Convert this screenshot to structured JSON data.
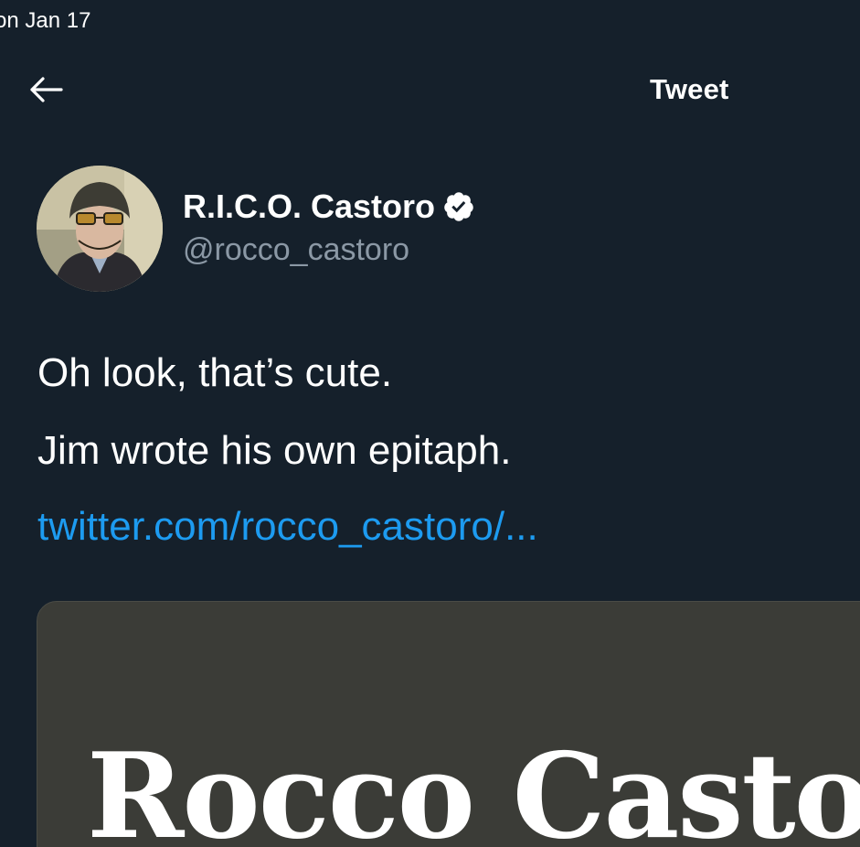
{
  "status_bar": {
    "time_text": "on Jan 17"
  },
  "header": {
    "back_icon": "arrow-left-icon",
    "title": "Tweet"
  },
  "author": {
    "name": "R.I.C.O. Castoro",
    "handle": "@rocco_castoro",
    "verified_icon": "verified-badge-icon"
  },
  "tweet": {
    "lines": [
      "Oh look, that’s cute.",
      "Jim wrote his own epitaph."
    ],
    "link_text": "twitter.com/rocco_castoro/..."
  },
  "media": {
    "card_text": "Rocco Castoro"
  },
  "colors": {
    "background": "#15202b",
    "link": "#1d9bf0",
    "secondary_text": "#8b98a5",
    "card_background": "#3b3c37"
  }
}
